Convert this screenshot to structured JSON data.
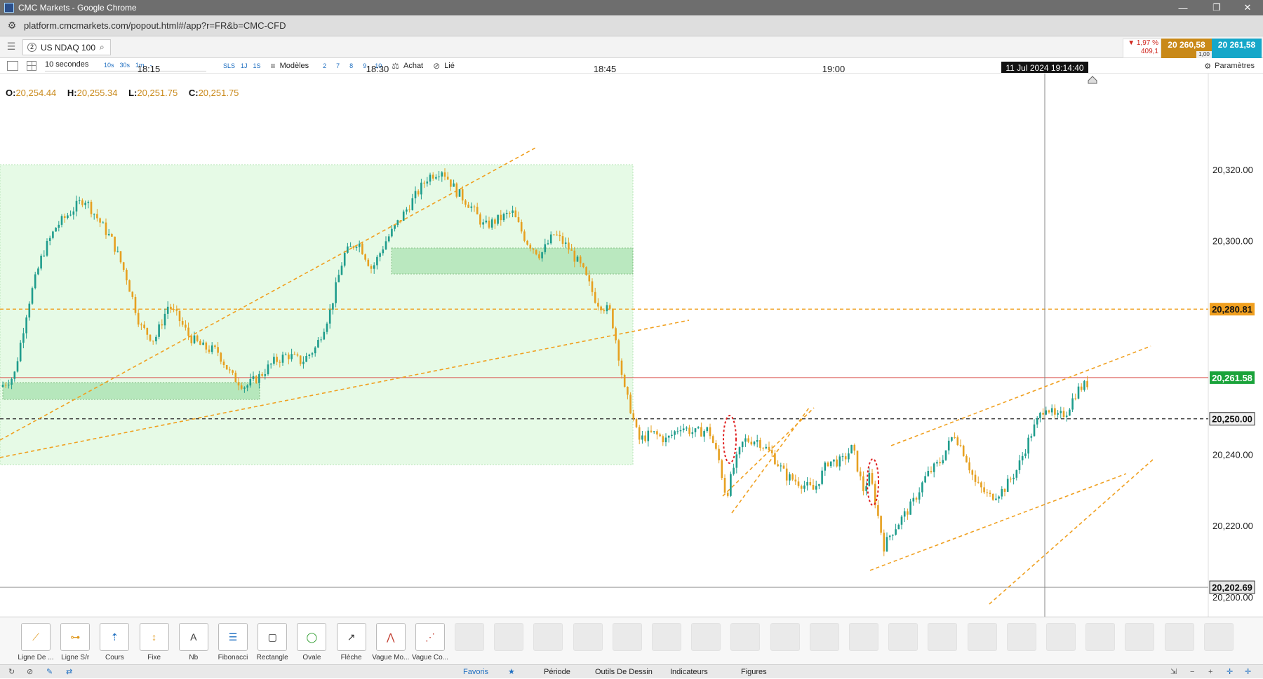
{
  "window": {
    "title": "CMC Markets - Google Chrome",
    "url": "platform.cmcmarkets.com/popout.html#/app?r=FR&b=CMC-CFD",
    "minimize": "—",
    "restore": "❐",
    "close": "✕"
  },
  "instrument": {
    "tab_number": "2",
    "name": "US NDAQ 100",
    "change_pct": "▼ 1,97 %",
    "change_pts": "409,1",
    "sell_price": "20 260,58",
    "buy_price": "20 261,58",
    "spread": "1,00"
  },
  "toolbar": {
    "interval": "10 secondes",
    "quick_intervals": [
      "10s",
      "30s",
      "1m",
      "-"
    ],
    "ranges": [
      "SLS",
      "1J",
      "1S"
    ],
    "models_label": "Modèles",
    "nums": [
      "2",
      "7",
      "8",
      "9",
      "10"
    ],
    "buy_label": "Achat",
    "linked_label": "Lié",
    "params_label": "Paramètres"
  },
  "ohlc": {
    "o_label": "O:",
    "o": "20,254.44",
    "h_label": "H:",
    "h": "20,255.34",
    "l_label": "L:",
    "l": "20,251.75",
    "c_label": "C:",
    "c": "20,251.75"
  },
  "chart_data": {
    "type": "candlestick",
    "x_ticks": [
      "18:15",
      "18:30",
      "18:45",
      "19:00"
    ],
    "crosshair_time": "11 Jul 2024 19:14:40",
    "y_ticks": [
      "20,320.00",
      "20,300.00",
      "20,240.00",
      "20,220.00",
      "20,200.00"
    ],
    "ylim": [
      20197,
      20346
    ],
    "price_labels": [
      {
        "value": 20280.81,
        "text": "20,280.81",
        "color": "#f0a020"
      },
      {
        "value": 20261.58,
        "text": "20,261.58",
        "color": "#1aa33a"
      },
      {
        "value": 20250.0,
        "text": "20,250.00",
        "color": "#333333"
      },
      {
        "value": 20202.69,
        "text": "20,202.69",
        "color": "#333333"
      }
    ],
    "horizontal_lines": [
      {
        "value": 20280.81,
        "style": "dashed",
        "color": "#f0a020"
      },
      {
        "value": 20261.58,
        "style": "solid",
        "color": "#d9534f"
      },
      {
        "value": 20250.0,
        "style": "dashed",
        "color": "#333333"
      },
      {
        "value": 20202.69,
        "style": "solid",
        "color": "#999999"
      }
    ],
    "up_color": "#1e9c8c",
    "down_color": "#e6a020",
    "close_path": [
      [
        0,
        20259
      ],
      [
        20,
        20262
      ],
      [
        40,
        20282
      ],
      [
        60,
        20296
      ],
      [
        80,
        20304
      ],
      [
        100,
        20308
      ],
      [
        120,
        20312
      ],
      [
        140,
        20306
      ],
      [
        160,
        20300
      ],
      [
        180,
        20290
      ],
      [
        200,
        20276
      ],
      [
        220,
        20272
      ],
      [
        240,
        20282
      ],
      [
        255,
        20278
      ],
      [
        270,
        20273
      ],
      [
        290,
        20270
      ],
      [
        310,
        20269
      ],
      [
        330,
        20262
      ],
      [
        350,
        20259
      ],
      [
        370,
        20262
      ],
      [
        390,
        20266
      ],
      [
        410,
        20268
      ],
      [
        430,
        20266
      ],
      [
        450,
        20270
      ],
      [
        470,
        20280
      ],
      [
        490,
        20296
      ],
      [
        510,
        20300
      ],
      [
        530,
        20292
      ],
      [
        550,
        20300
      ],
      [
        570,
        20306
      ],
      [
        590,
        20312
      ],
      [
        610,
        20318
      ],
      [
        630,
        20320
      ],
      [
        650,
        20314
      ],
      [
        670,
        20310
      ],
      [
        690,
        20304
      ],
      [
        710,
        20306
      ],
      [
        730,
        20308
      ],
      [
        750,
        20300
      ],
      [
        770,
        20296
      ],
      [
        790,
        20302
      ],
      [
        810,
        20298
      ],
      [
        830,
        20292
      ],
      [
        850,
        20283
      ],
      [
        870,
        20280
      ],
      [
        880,
        20270
      ],
      [
        890,
        20258
      ],
      [
        900,
        20252
      ],
      [
        910,
        20244
      ],
      [
        930,
        20246
      ],
      [
        950,
        20244
      ],
      [
        970,
        20248
      ],
      [
        990,
        20246
      ],
      [
        1010,
        20247
      ],
      [
        1025,
        20238
      ],
      [
        1035,
        20228
      ],
      [
        1045,
        20236
      ],
      [
        1060,
        20244
      ],
      [
        1080,
        20244
      ],
      [
        1100,
        20240
      ],
      [
        1120,
        20234
      ],
      [
        1140,
        20232
      ],
      [
        1160,
        20230
      ],
      [
        1180,
        20238
      ],
      [
        1200,
        20238
      ],
      [
        1215,
        20242
      ],
      [
        1230,
        20230
      ],
      [
        1240,
        20234
      ],
      [
        1250,
        20224
      ],
      [
        1260,
        20214
      ],
      [
        1270,
        20218
      ],
      [
        1285,
        20222
      ],
      [
        1300,
        20226
      ],
      [
        1320,
        20234
      ],
      [
        1340,
        20238
      ],
      [
        1360,
        20246
      ],
      [
        1375,
        20240
      ],
      [
        1390,
        20232
      ],
      [
        1410,
        20228
      ],
      [
        1430,
        20230
      ],
      [
        1450,
        20236
      ],
      [
        1470,
        20246
      ],
      [
        1490,
        20254
      ],
      [
        1505,
        20250
      ],
      [
        1520,
        20252
      ],
      [
        1535,
        20258
      ],
      [
        1550,
        20260
      ]
    ]
  },
  "drawing_tools": [
    {
      "label": "Ligne De ...",
      "icon": "line-icon"
    },
    {
      "label": "Ligne S/r",
      "icon": "sr-line-icon"
    },
    {
      "label": "Cours",
      "icon": "price-icon"
    },
    {
      "label": "Fixe",
      "icon": "fixed-icon"
    },
    {
      "label": "Nb",
      "icon": "text-icon"
    },
    {
      "label": "Fibonacci",
      "icon": "fibonacci-icon"
    },
    {
      "label": "Rectangle",
      "icon": "rectangle-icon"
    },
    {
      "label": "Ovale",
      "icon": "oval-icon"
    },
    {
      "label": "Flèche",
      "icon": "arrow-icon"
    },
    {
      "label": "Vague Mo...",
      "icon": "wave-icon"
    },
    {
      "label": "Vague Co...",
      "icon": "wave2-icon"
    }
  ],
  "bottom_tabs": {
    "favoris": "Favoris",
    "periode": "Période",
    "outils": "Outils De Dessin",
    "indicateurs": "Indicateurs",
    "figures": "Figures"
  },
  "toolbar_text": {
    "nb_icon": "A"
  }
}
